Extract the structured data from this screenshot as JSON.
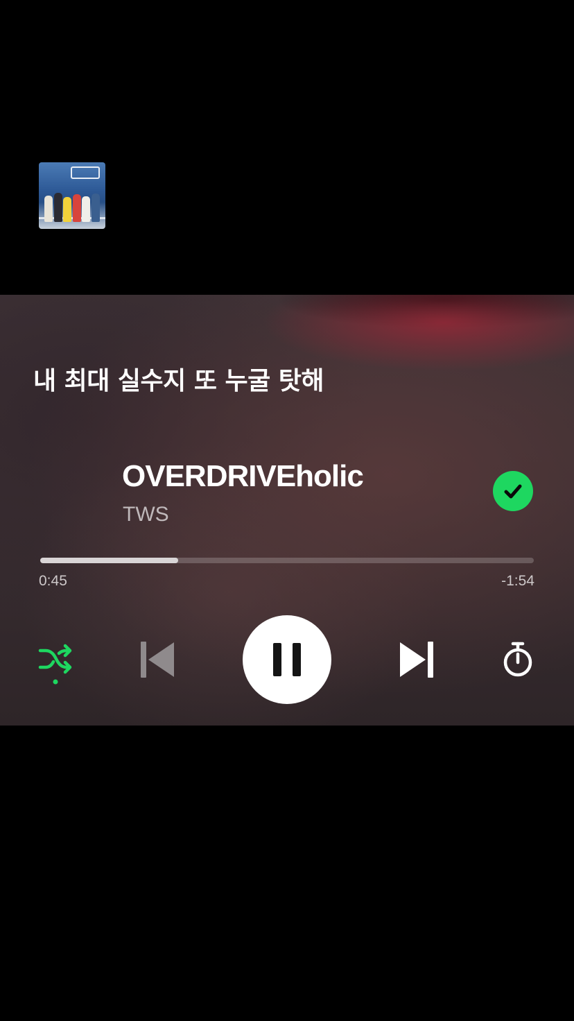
{
  "lyrics": {
    "current_line": "내 최대 실수지 또 누굴 탓해"
  },
  "track": {
    "title": "OVERDRIVEholic",
    "artist": "TWS",
    "liked": true
  },
  "playback": {
    "elapsed": "0:45",
    "remaining": "-1:54",
    "progress_fraction": 0.28,
    "state": "playing",
    "shuffle_enabled": true
  },
  "icons": {
    "liked": "check-circle-icon",
    "shuffle": "shuffle-icon",
    "previous": "skip-previous-icon",
    "pause": "pause-icon",
    "next": "skip-next-icon",
    "sleep_timer": "timer-icon"
  },
  "colors": {
    "accent": "#1ed760",
    "text_primary": "#ffffff",
    "text_secondary": "#bfb8ba"
  }
}
